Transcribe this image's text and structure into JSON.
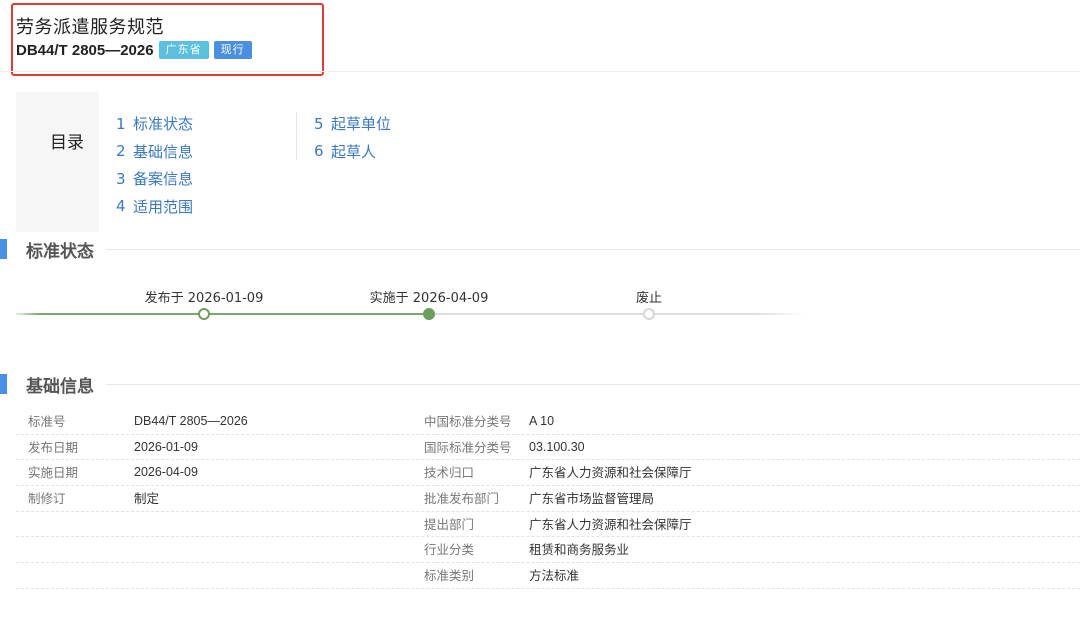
{
  "header": {
    "title": "劳务派遣服务规范",
    "code": "DB44/T 2805—2026",
    "region_badge": "广东省",
    "status_badge": "现行"
  },
  "toc": {
    "label": "目录",
    "col1": [
      {
        "num": "1",
        "label": "标准状态"
      },
      {
        "num": "2",
        "label": "基础信息"
      },
      {
        "num": "3",
        "label": "备案信息"
      },
      {
        "num": "4",
        "label": "适用范围"
      }
    ],
    "col2": [
      {
        "num": "5",
        "label": "起草单位"
      },
      {
        "num": "6",
        "label": "起草人"
      }
    ]
  },
  "status_section": {
    "title": "标准状态",
    "timeline": [
      {
        "label": "发布于 2026-01-09",
        "state": "passed"
      },
      {
        "label": "实施于 2026-04-09",
        "state": "current"
      },
      {
        "label": "废止",
        "state": "pending"
      }
    ]
  },
  "basic_section": {
    "title": "基础信息",
    "rows": [
      {
        "l1": "标准号",
        "v1": "DB44/T 2805—2026",
        "l2": "中国标准分类号",
        "v2": "A 10"
      },
      {
        "l1": "发布日期",
        "v1": "2026-01-09",
        "l2": "国际标准分类号",
        "v2": "03.100.30"
      },
      {
        "l1": "实施日期",
        "v1": "2026-04-09",
        "l2": "技术归口",
        "v2": "广东省人力资源和社会保障厅"
      },
      {
        "l1": "制修订",
        "v1": "制定",
        "l2": "批准发布部门",
        "v2": "广东省市场监督管理局"
      },
      {
        "l1": "",
        "v1": "",
        "l2": "提出部门",
        "v2": "广东省人力资源和社会保障厅"
      },
      {
        "l1": "",
        "v1": "",
        "l2": "行业分类",
        "v2": "租赁和商务服务业"
      },
      {
        "l1": "",
        "v1": "",
        "l2": "标准类别",
        "v2": "方法标准"
      }
    ]
  },
  "colors": {
    "accent_blue": "#4a90e2",
    "link_blue": "#3a78c3",
    "timeline_green": "#6e9e5d",
    "highlight_red": "#e03a3a"
  }
}
